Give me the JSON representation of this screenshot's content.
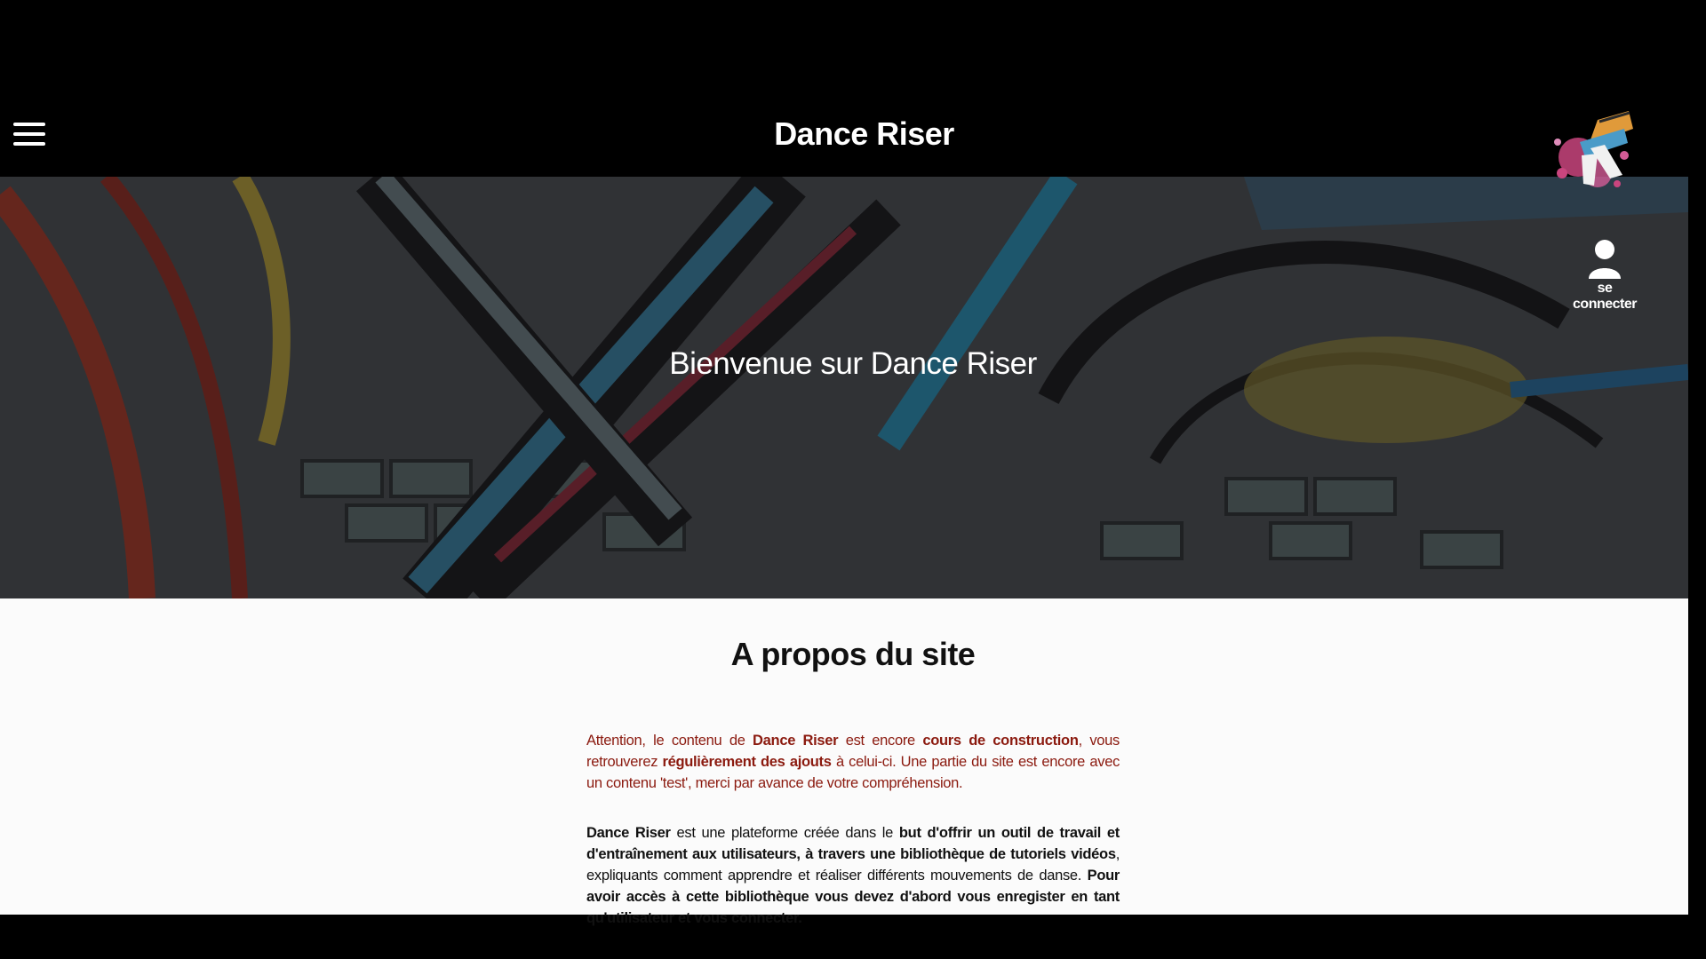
{
  "header": {
    "menu_icon": "hamburger-menu-icon",
    "title": "Dance Riser",
    "logo_icon": "dance-riser-logo"
  },
  "hero": {
    "title": "Bienvenue sur Dance Riser",
    "login": {
      "icon": "user-icon",
      "label": "se connecter"
    }
  },
  "about": {
    "title": "A propos du site",
    "warning": {
      "t1": "Attention, le contenu de ",
      "b1": "Dance Riser",
      "t2": " est encore ",
      "b2": "cours de construction",
      "t3": ", vous retrouverez ",
      "b3": "régulièrement des ajouts",
      "t4": " à celui-ci. Une partie du site est encore avec un contenu 'test', merci par avance de votre compréhension."
    },
    "description": {
      "b1": "Dance Riser",
      "t1": " est une plateforme créée dans le ",
      "b2": "but d'offrir un outil de travail et d'entraînement aux utilisateurs, à travers une bibliothèque de tutoriels vidéos",
      "t2": ", expliquants comment apprendre et réaliser différents mouvements de danse. ",
      "b3": "Pour avoir accès à cette bibliothèque vous devez d'abord vous enregister en tant qu'utilisateur et vous connecter."
    }
  },
  "colors": {
    "page_bg": "#000000",
    "content_bg": "#fbfbfb",
    "warning_text": "#8b1a0f",
    "text": "#111111"
  }
}
